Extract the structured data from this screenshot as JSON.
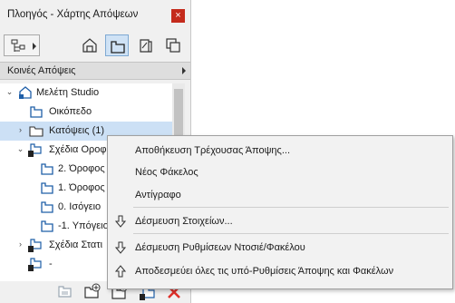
{
  "window": {
    "title": "Πλοηγός - Χάρτης Απόψεων",
    "close_label": "×"
  },
  "toolbar": {
    "buttons": [
      "project-map-icon",
      "view-map-icon",
      "layout-book-icon",
      "publisher-icon"
    ],
    "active": 1
  },
  "header": {
    "label": "Κοινές Απόψεις"
  },
  "tree": {
    "items": [
      {
        "label": "Μελέτη Studio",
        "icon": "project-house-icon",
        "expander": "open"
      },
      {
        "label": "Οικόπεδο",
        "icon": "view-icon",
        "expander": ""
      },
      {
        "label": "Κατόψεις (1)",
        "icon": "folder-icon",
        "expander": "closed",
        "selected": true
      },
      {
        "label": "Σχέδια Οροφ",
        "icon": "linked-folder-icon",
        "expander": "open"
      },
      {
        "label": "2. Όροφος",
        "icon": "view-icon",
        "expander": ""
      },
      {
        "label": "1. Όροφος",
        "icon": "view-icon",
        "expander": ""
      },
      {
        "label": "0. Ισόγειο",
        "icon": "view-icon",
        "expander": ""
      },
      {
        "label": "-1. Υπόγειο",
        "icon": "view-icon",
        "expander": ""
      },
      {
        "label": "Σχέδια Στατι",
        "icon": "linked-folder-icon",
        "expander": "closed"
      },
      {
        "label": "-",
        "icon": "linked-folder-icon",
        "expander": ""
      }
    ]
  },
  "bottombar": {
    "buttons": [
      "clone-folder-icon",
      "new-folder-icon",
      "save-view-icon",
      "link-icon",
      "delete-icon"
    ]
  },
  "context_menu": {
    "items": [
      {
        "label": "Αποθήκευση Τρέχουσας Άποψης...",
        "icon": ""
      },
      {
        "label": "Νέος Φάκελος",
        "icon": ""
      },
      {
        "label": "Αντίγραφο",
        "icon": ""
      },
      {
        "label": "Δέσμευση Στοιχείων...",
        "icon": "arrow-down-icon"
      },
      {
        "label": "Δέσμευση Ρυθμίσεων Ντοσιέ/Φακέλου",
        "icon": "arrow-down-icon"
      },
      {
        "label": "Αποδεσμεύει όλες τις υπό-Ρυθμίσεις Άποψης και Φακέλων",
        "icon": "arrow-up-icon"
      }
    ]
  },
  "colors": {
    "selection": "#cce0f5",
    "close": "#c42b1c",
    "accent": "#1f5fa8"
  }
}
